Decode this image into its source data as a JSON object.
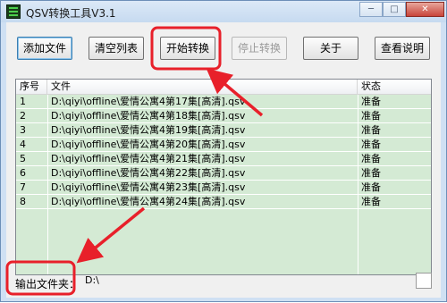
{
  "window": {
    "title": "QSV转换工具V3.1",
    "controls": {
      "minimize": "─",
      "maximize": "□",
      "close": "✕"
    }
  },
  "toolbar": {
    "add_file": "添加文件",
    "clear_list": "清空列表",
    "start_convert": "开始转换",
    "stop_convert": "停止转换",
    "about": "关于",
    "help": "查看说明"
  },
  "list": {
    "columns": {
      "index": "序号",
      "file": "文件",
      "status": "状态"
    },
    "rows": [
      {
        "index": "1",
        "file": "D:\\qiyi\\offline\\爱情公寓4第17集[高清].qsv",
        "status": "准备"
      },
      {
        "index": "2",
        "file": "D:\\qiyi\\offline\\爱情公寓4第18集[高清].qsv",
        "status": "准备"
      },
      {
        "index": "3",
        "file": "D:\\qiyi\\offline\\爱情公寓4第19集[高清].qsv",
        "status": "准备"
      },
      {
        "index": "4",
        "file": "D:\\qiyi\\offline\\爱情公寓4第20集[高清].qsv",
        "status": "准备"
      },
      {
        "index": "5",
        "file": "D:\\qiyi\\offline\\爱情公寓4第21集[高清].qsv",
        "status": "准备"
      },
      {
        "index": "6",
        "file": "D:\\qiyi\\offline\\爱情公寓4第22集[高清].qsv",
        "status": "准备"
      },
      {
        "index": "7",
        "file": "D:\\qiyi\\offline\\爱情公寓4第23集[高清].qsv",
        "status": "准备"
      },
      {
        "index": "8",
        "file": "D:\\qiyi\\offline\\爱情公寓4第24集[高清].qsv",
        "status": "准备"
      }
    ]
  },
  "output": {
    "label": "输出文件夹：",
    "path": "D:\\"
  },
  "colors": {
    "annotation": "#e8202a",
    "list_bg": "#d4ead4",
    "title_bg": "#cfe0f3"
  },
  "icons": [
    "app-icon",
    "minimize-icon",
    "maximize-icon",
    "close-icon"
  ]
}
